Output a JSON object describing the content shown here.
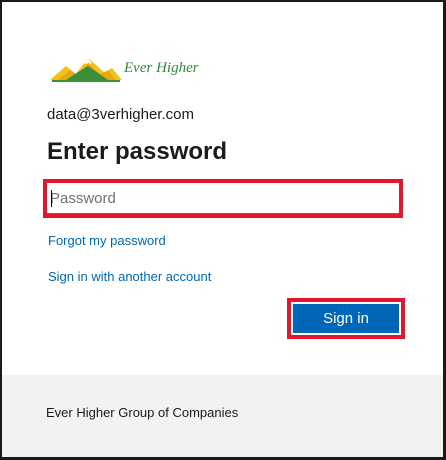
{
  "branding": {
    "company_name": "Ever Higher"
  },
  "identity": {
    "email": "data@3verhigher.com"
  },
  "page": {
    "title": "Enter password"
  },
  "password_field": {
    "placeholder": "Password",
    "value": ""
  },
  "links": {
    "forgot_password": "Forgot my password",
    "other_account": "Sign in with another account"
  },
  "actions": {
    "sign_in": "Sign in"
  },
  "footer": {
    "text": "Ever Higher Group of Companies"
  },
  "colors": {
    "accent": "#0067b8",
    "highlight": "#e0182b",
    "footer_bg": "#f2f2f2"
  }
}
